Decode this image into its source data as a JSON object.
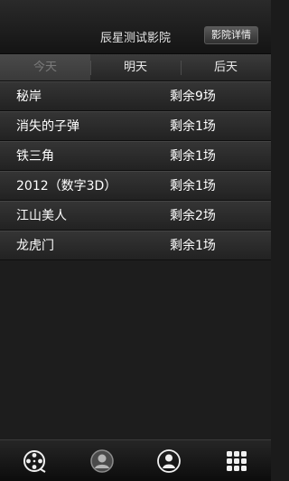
{
  "header": {
    "title": "辰星测试影院",
    "detail_button_label": "影院详情"
  },
  "tabs": [
    {
      "label": "今天",
      "active": true
    },
    {
      "label": "明天",
      "active": false
    },
    {
      "label": "后天",
      "active": false
    }
  ],
  "movies": [
    {
      "title": "秘岸",
      "remaining": "剩余9场"
    },
    {
      "title": "消失的子弹",
      "remaining": "剩余1场"
    },
    {
      "title": "铁三角",
      "remaining": "剩余1场"
    },
    {
      "title": "2012（数字3D）",
      "remaining": "剩余1场"
    },
    {
      "title": "江山美人",
      "remaining": "剩余2场"
    },
    {
      "title": "龙虎门",
      "remaining": "剩余1场"
    }
  ],
  "bottom_nav": [
    {
      "icon": "film-reel-icon"
    },
    {
      "icon": "user-profile-icon"
    },
    {
      "icon": "person-icon"
    },
    {
      "icon": "grid-menu-icon"
    }
  ]
}
